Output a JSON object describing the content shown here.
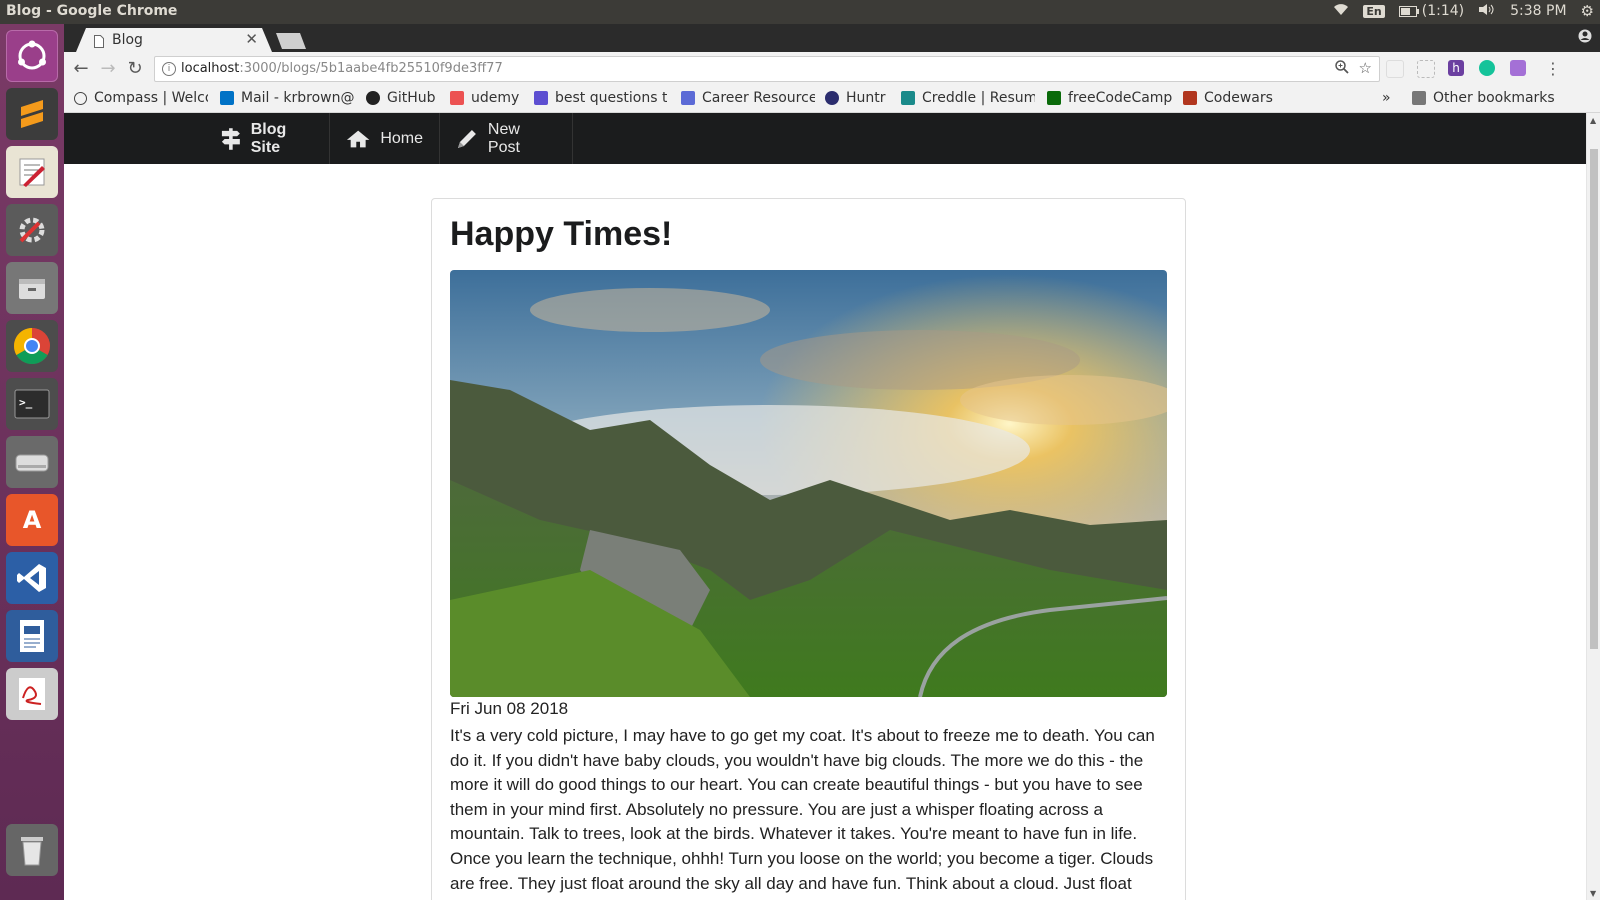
{
  "os": {
    "window_title": "Blog - Google Chrome",
    "keyboard": "En",
    "battery": "(1:14)",
    "time": "5:38 PM"
  },
  "browser": {
    "tab_title": "Blog",
    "url_host": "localhost",
    "url_path": ":3000/blogs/5b1aabe4fb25510f9de3ff77",
    "bookmarks": [
      {
        "label": "Compass | Welco",
        "color": "#444444"
      },
      {
        "label": "Mail - krbrown@",
        "color": "#0072c6"
      },
      {
        "label": "GitHub",
        "color": "#222222"
      },
      {
        "label": "udemy",
        "color": "#ec5252"
      },
      {
        "label": "best questions t",
        "color": "#5d4fd1"
      },
      {
        "label": "Career Resource",
        "color": "#5b6ad6"
      },
      {
        "label": "Huntr",
        "color": "#2b2d6e"
      },
      {
        "label": "Creddle | Resum",
        "color": "#1a8a8a"
      },
      {
        "label": "freeCodeCamp",
        "color": "#0a6a0a"
      },
      {
        "label": "Codewars",
        "color": "#b1361e"
      }
    ],
    "bookmarks_overflow": "»",
    "other_bookmarks": "Other bookmarks"
  },
  "site": {
    "brand": "Blog Site",
    "nav": [
      "Home",
      "New Post"
    ]
  },
  "post": {
    "title": "Happy Times!",
    "date": "Fri Jun 08 2018",
    "body": "It's a very cold picture, I may have to go get my coat. It's about to freeze me to death. You can do it. If you didn't have baby clouds, you wouldn't have big clouds. The more we do this - the more it will do good things to our heart. You can create beautiful things - but you have to see them in your mind first. Absolutely no pressure. You are just a whisper floating across a mountain. Talk to trees, look at the birds. Whatever it takes. You're meant to have fun in life. Once you learn the technique, ohhh! Turn you loose on the world; you become a tiger. Clouds are free. They just float around the sky all day and have fun. Think about a cloud. Just float around and be there."
  },
  "colors": {
    "navbar": "#1b1c1d",
    "launcher": "#6b3360"
  },
  "icons": [
    "ubuntu-icon",
    "sublime-icon",
    "editor-icon",
    "settings-icon",
    "files-icon",
    "chrome-icon",
    "terminal-icon",
    "disk-icon",
    "software-center-icon",
    "vscode-icon",
    "writer-icon",
    "evince-icon",
    "trash-icon"
  ]
}
